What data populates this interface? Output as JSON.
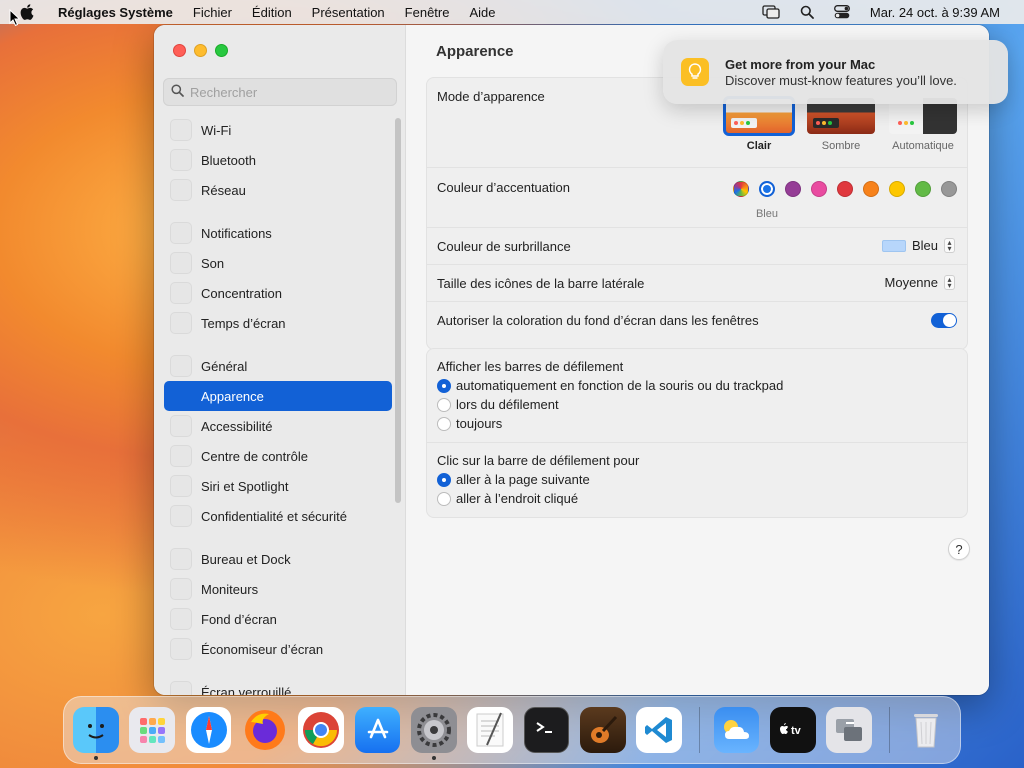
{
  "menubar": {
    "app_name": "Réglages Système",
    "menus": [
      "Fichier",
      "Édition",
      "Présentation",
      "Fenêtre",
      "Aide"
    ],
    "datetime": "Mar. 24 oct. à 9:39 AM"
  },
  "sidebar": {
    "search_placeholder": "Rechercher",
    "groups": [
      [
        "Wi-Fi",
        "Bluetooth",
        "Réseau"
      ],
      [
        "Notifications",
        "Son",
        "Concentration",
        "Temps d’écran"
      ],
      [
        "Général",
        "Apparence",
        "Accessibilité",
        "Centre de contrôle",
        "Siri et Spotlight",
        "Confidentialité et sécurité"
      ],
      [
        "Bureau et Dock",
        "Moniteurs",
        "Fond d’écran",
        "Économiseur d’écran",
        "Écran verrouillé"
      ]
    ],
    "active_item": "Apparence"
  },
  "main": {
    "title": "Apparence",
    "appearance_mode": {
      "label": "Mode d’apparence",
      "options": [
        "Clair",
        "Sombre",
        "Automatique"
      ],
      "selected": "Clair"
    },
    "accent_color": {
      "label": "Couleur d’accentuation",
      "selected_name": "Bleu",
      "colors": [
        "multicolor",
        "#1a73e8",
        "#953d96",
        "#e94ba0",
        "#e0383e",
        "#f7821b",
        "#fdc700",
        "#62ba46",
        "#989898"
      ]
    },
    "highlight_color": {
      "label": "Couleur de surbrillance",
      "value": "Bleu",
      "chip_color": "#b7d6fb"
    },
    "sidebar_icon_size": {
      "label": "Taille des icônes de la barre latérale",
      "value": "Moyenne"
    },
    "wallpaper_tinting": {
      "label": "Autoriser la coloration du fond d’écran dans les fenêtres",
      "enabled": true
    },
    "show_scrollbars": {
      "label": "Afficher les barres de défilement",
      "options": [
        "automatiquement en fonction de la souris ou du trackpad",
        "lors du défilement",
        "toujours"
      ],
      "selected_index": 0
    },
    "click_scrollbar": {
      "label": "Clic sur la barre de défilement pour",
      "options": [
        "aller à la page suivante",
        "aller à l’endroit cliqué"
      ],
      "selected_index": 0
    },
    "help_label": "?"
  },
  "notification": {
    "title": "Get more from your Mac",
    "body": "Discover must-know features you’ll love."
  },
  "dock": {
    "apps": [
      "finder",
      "launchpad",
      "safari",
      "firefox",
      "chrome",
      "app-store",
      "system-settings",
      "textedit",
      "terminal",
      "garageband",
      "vscode"
    ],
    "apps_right": [
      "weather",
      "apple-tv",
      "migration-assistant"
    ],
    "trash": "trash",
    "running": [
      "finder",
      "system-settings"
    ]
  }
}
